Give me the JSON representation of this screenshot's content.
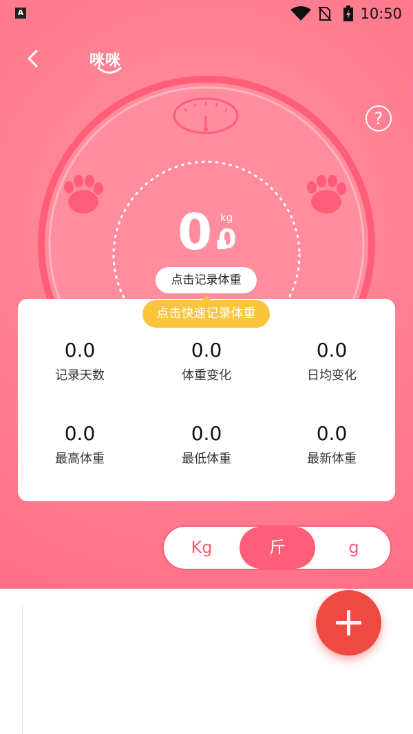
{
  "status_bar": {
    "time": "10:50",
    "notification_icon": "A"
  },
  "header": {
    "title": "咪咪",
    "back_icon": "chevron-left-icon",
    "help_icon": "?"
  },
  "scale": {
    "weight_int": "0.",
    "weight_dec": "0",
    "unit": "kg",
    "record_button": "点击记录体重"
  },
  "tooltip": "点击快速记录体重",
  "stats": [
    {
      "value": "0.0",
      "label": "记录天数"
    },
    {
      "value": "0.0",
      "label": "体重变化"
    },
    {
      "value": "0.0",
      "label": "日均变化"
    },
    {
      "value": "0.0",
      "label": "最高体重"
    },
    {
      "value": "0.0",
      "label": "最低体重"
    },
    {
      "value": "0.0",
      "label": "最新体重"
    }
  ],
  "units": {
    "options": [
      "Kg",
      "斤",
      "g"
    ],
    "selected": "斤"
  },
  "colors": {
    "primary": "#ff6f86",
    "accent": "#ff5d78",
    "fab": "#ee4a43",
    "tooltip": "#f9c53c"
  }
}
